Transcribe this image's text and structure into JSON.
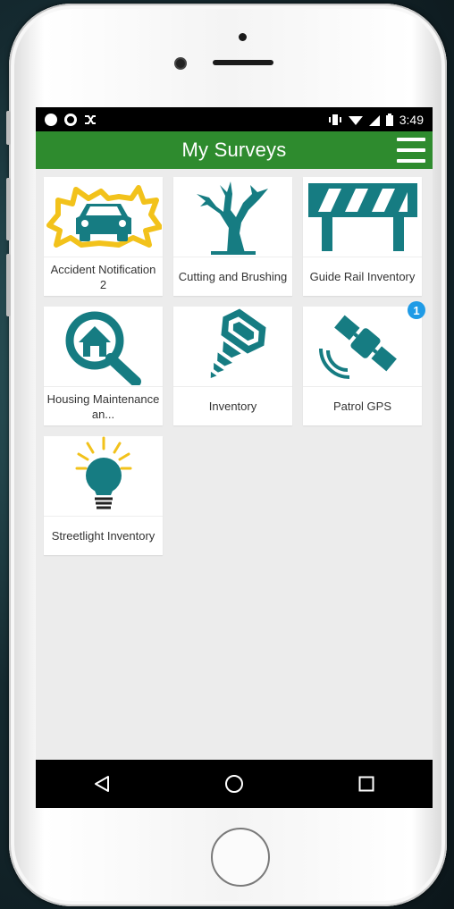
{
  "statusbar": {
    "time": "3:49",
    "left_icons": [
      "music-icon",
      "sync-icon",
      "shuffle-icon"
    ],
    "right_icons": [
      "vibrate-icon",
      "wifi-icon",
      "signal-icon",
      "battery-icon"
    ]
  },
  "appbar": {
    "title": "My Surveys",
    "menu_icon": "hamburger-menu-icon",
    "color": "#2e8b2e"
  },
  "surveys": [
    {
      "label": "Accident Notification 2",
      "icon": "car-accident-icon"
    },
    {
      "label": "Cutting and Brushing",
      "icon": "bare-tree-icon"
    },
    {
      "label": "Guide Rail Inventory",
      "icon": "guide-rail-icon"
    },
    {
      "label": "Housing Maintenance an...",
      "icon": "house-search-icon"
    },
    {
      "label": "Inventory",
      "icon": "screw-icon"
    },
    {
      "label": "Patrol GPS",
      "icon": "satellite-icon",
      "badge": "1"
    },
    {
      "label": "Streetlight Inventory",
      "icon": "light-bulb-icon"
    }
  ],
  "navbar": {
    "back_icon": "back-triangle-icon",
    "home_icon": "home-circle-icon",
    "recents_icon": "recents-square-icon"
  },
  "colors": {
    "teal": "#167c82",
    "yellow": "#f2c21b",
    "badge": "#1f9be6"
  }
}
